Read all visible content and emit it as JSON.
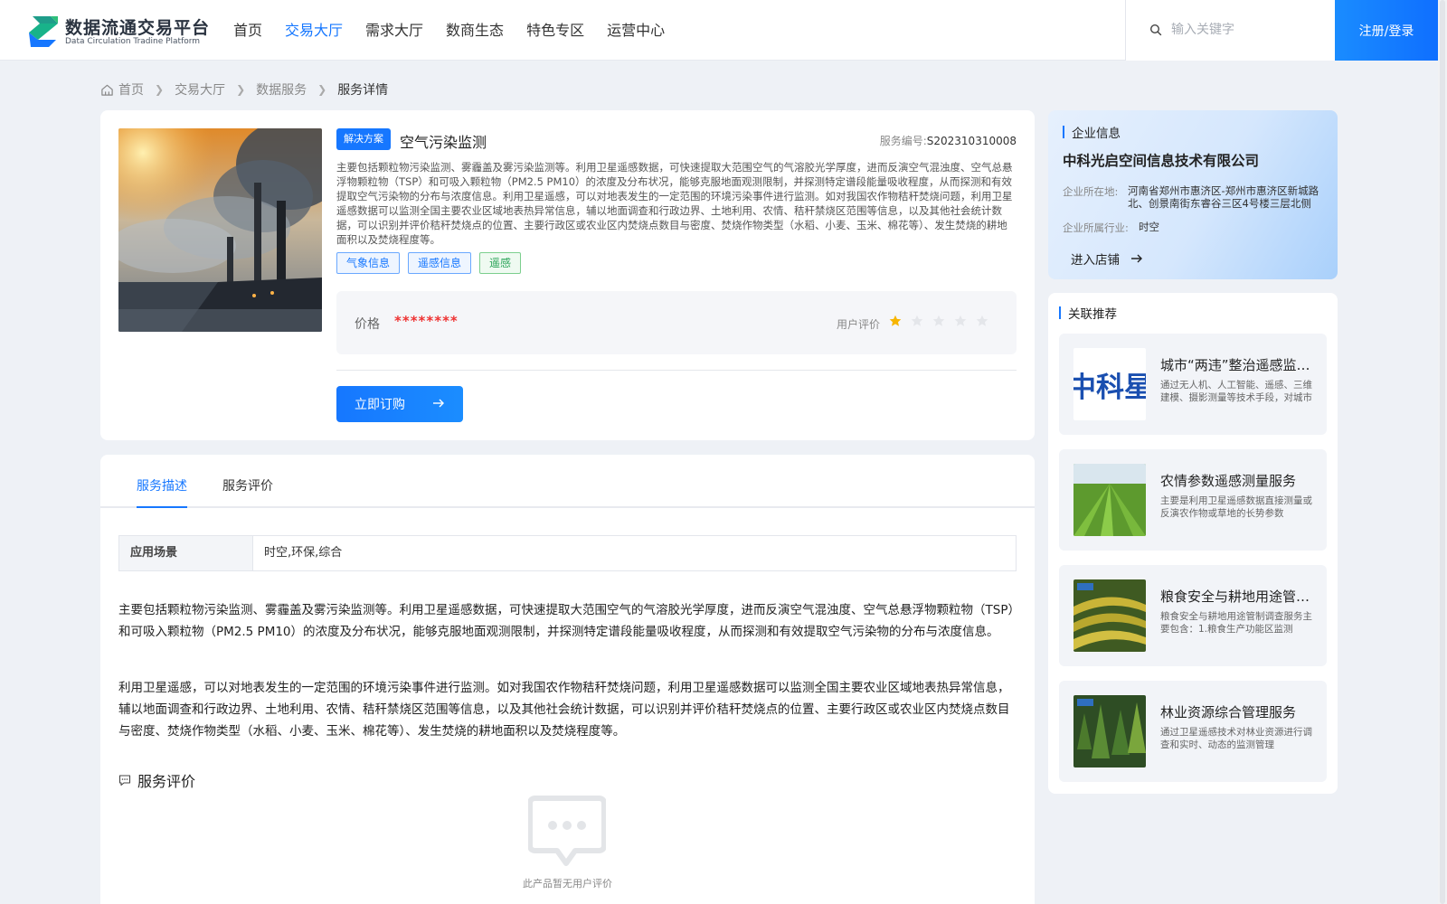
{
  "header": {
    "logo_title": "数据流通交易平台",
    "logo_subtitle": "Data Circulation Tradine Platform",
    "nav": [
      "首页",
      "交易大厅",
      "需求大厅",
      "数商生态",
      "特色专区",
      "运营中心"
    ],
    "nav_active_index": 1,
    "search_placeholder": "输入关键字",
    "login_label": "注册/登录",
    "accent_color": "#1677ff"
  },
  "breadcrumb": [
    "首页",
    "交易大厅",
    "数据服务",
    "服务详情"
  ],
  "product": {
    "badge": "解决方案",
    "title": "空气污染监测",
    "service_no_label": "服务编号:",
    "service_no": "S202310310008",
    "description": "主要包括颗粒物污染监测、雾霾盖及雾污染监测等。利用卫星遥感数据，可快速提取大范围空气的气溶胶光学厚度，进而反演空气混浊度、空气总悬浮物颗粒物（TSP）和可吸入颗粒物（PM2.5 PM10）的浓度及分布状况，能够克服地面观测限制，并探测特定谱段能量吸收程度，从而探测和有效提取空气污染物的分布与浓度信息。利用卫星遥感，可以对地表发生的一定范围的环境污染事件进行监测。如对我国农作物秸秆焚烧问题，利用卫星遥感数据可以监测全国主要农业区域地表热异常信息，辅以地面调查和行政边界、土地利用、农情、秸秆禁烧区范围等信息，以及其他社会统计数据，可以识别并评价秸秆焚烧点的位置、主要行政区或农业区内焚烧点数目与密度、焚烧作物类型（水稻、小麦、玉米、棉花等）、发生焚烧的耕地面积以及焚烧程度等。",
    "tags": [
      "气象信息",
      "遥感信息",
      "遥感"
    ],
    "price_label": "价格",
    "price_value": "********",
    "rating_label": "用户评价",
    "rating": 1,
    "rating_max": 5,
    "order_label": "立即订购"
  },
  "detail": {
    "tabs": [
      "服务描述",
      "服务评价"
    ],
    "active_tab": 0,
    "scene_key": "应用场景",
    "scene_value": "时空,环保,综合",
    "paragraph1": "主要包括颗粒物污染监测、雾霾盖及雾污染监测等。利用卫星遥感数据，可快速提取大范围空气的气溶胶光学厚度，进而反演空气混浊度、空气总悬浮物颗粒物（TSP）和可吸入颗粒物（PM2.5 PM10）的浓度及分布状况，能够克服地面观测限制，并探测特定谱段能量吸收程度，从而探测和有效提取空气污染物的分布与浓度信息。",
    "paragraph2": "利用卫星遥感，可以对地表发生的一定范围的环境污染事件进行监测。如对我国农作物秸秆焚烧问题，利用卫星遥感数据可以监测全国主要农业区域地表热异常信息，辅以地面调查和行政边界、土地利用、农情、秸秆禁烧区范围等信息，以及其他社会统计数据，可以识别并评价秸秆焚烧点的位置、主要行政区或农业区内焚烧点数目与密度、焚烧作物类型（水稻、小麦、玉米、棉花等）、发生焚烧的耕地面积以及焚烧程度等。",
    "review_title": "服务评价",
    "empty_text": "此产品暂无用户评价"
  },
  "enterprise": {
    "section_title": "企业信息",
    "name": "中科光启空间信息技术有限公司",
    "addr_label": "企业所在地:",
    "addr_value": "河南省郑州市惠济区-郑州市惠济区新城路北、创景南街东睿谷三区4号楼三层北侧",
    "industry_label": "企业所属行业:",
    "industry_value": "时空",
    "enter_label": "进入店铺"
  },
  "recommend": {
    "section_title": "关联推荐",
    "items": [
      {
        "title": "城市“两违”整治遥感监测服务",
        "desc": "通过无人机、人工智能、遥感、三维建模、摄影测量等技术手段，对城市违法建设进行监测",
        "thumb": "logo-text-icon",
        "thumb_text": "中科星"
      },
      {
        "title": "农情参数遥感测量服务",
        "desc": "主要是利用卫星遥感数据直接测量或反演农作物或草地的长势参数",
        "thumb": "farmland-photo"
      },
      {
        "title": "粮食安全与耕地用途管制调查服务",
        "desc": "粮食安全与耕地用途管制调查服务主要包含：1.粮食生产功能区监测",
        "thumb": "terrace-photo"
      },
      {
        "title": "林业资源综合管理服务",
        "desc": "通过卫星遥感技术对林业资源进行调查和实时、动态的监测管理",
        "thumb": "forest-photo"
      }
    ]
  }
}
